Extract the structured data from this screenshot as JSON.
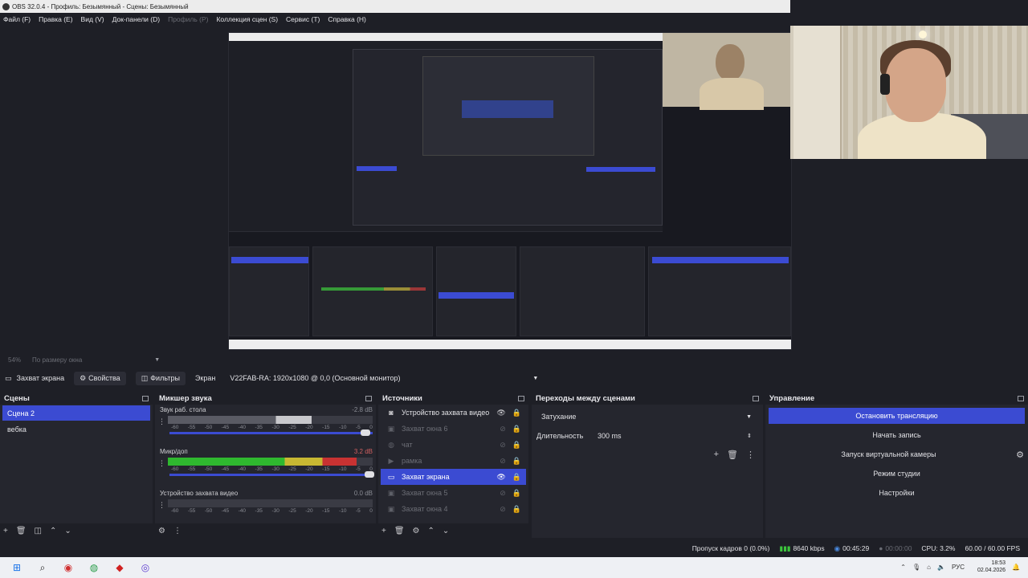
{
  "window": {
    "title": "OBS 32.0.4 - Профиль: Безымянный - Сцены: Безымянный"
  },
  "menu": [
    {
      "label": "Файл (F)",
      "enabled": true
    },
    {
      "label": "Правка (E)",
      "enabled": true
    },
    {
      "label": "Вид (V)",
      "enabled": true
    },
    {
      "label": "Док-панели (D)",
      "enabled": true
    },
    {
      "label": "Профиль (P)",
      "enabled": false
    },
    {
      "label": "Коллекция сцен (S)",
      "enabled": true
    },
    {
      "label": "Сервис (T)",
      "enabled": true
    },
    {
      "label": "Справка (H)",
      "enabled": true
    }
  ],
  "preview": {
    "zoom": "54%",
    "scale_mode": "По размеру окна"
  },
  "source_toolbar": {
    "source_name": "Захват экрана",
    "properties_label": "Свойства",
    "filters_label": "Фильтры",
    "screen_label": "Экран",
    "screen_value": "V22FAB-RA: 1920x1080 @ 0,0 (Основной монитор)"
  },
  "scenes": {
    "title": "Сцены",
    "items": [
      {
        "label": "Сцена 2",
        "active": true
      },
      {
        "label": "вебка",
        "active": false
      }
    ]
  },
  "mixer": {
    "title": "Микшер звука",
    "tracks": [
      {
        "name": "Звук раб. стола",
        "db": "-2.8 dB",
        "level": 0.7,
        "fader": 0.95,
        "muted": false
      },
      {
        "name": "Микр/доп",
        "db": "3.2 dB",
        "level": 0.92,
        "fader": 1.0,
        "muted": false
      },
      {
        "name": "Устройство захвата видео",
        "db": "0.0 dB",
        "level": 0.0,
        "fader": 1.0,
        "muted": false
      }
    ],
    "scale": [
      "-60",
      "-55",
      "-50",
      "-45",
      "-40",
      "-35",
      "-30",
      "-25",
      "-20",
      "-15",
      "-10",
      "-5",
      "0"
    ]
  },
  "sources": {
    "title": "Источники",
    "items": [
      {
        "label": "Устройство захвата видео",
        "icon": "video-camera-icon",
        "visible": true,
        "state": "normal"
      },
      {
        "label": "Захват окна 6",
        "icon": "window-icon",
        "visible": false,
        "state": "dim"
      },
      {
        "label": "чат",
        "icon": "browser-icon",
        "visible": false,
        "state": "dim"
      },
      {
        "label": "рамка",
        "icon": "media-icon",
        "visible": false,
        "state": "dim"
      },
      {
        "label": "Захват экрана",
        "icon": "monitor-icon",
        "visible": true,
        "state": "active"
      },
      {
        "label": "Захват окна 5",
        "icon": "window-icon",
        "visible": false,
        "state": "dim"
      },
      {
        "label": "Захват окна 4",
        "icon": "window-icon",
        "visible": false,
        "state": "dim"
      }
    ]
  },
  "transitions": {
    "title": "Переходы между сценами",
    "selected": "Затухание",
    "duration_label": "Длительность",
    "duration_value": "300 ms"
  },
  "controls": {
    "title": "Управление",
    "stop_stream": "Остановить трансляцию",
    "start_record": "Начать запись",
    "virtual_cam": "Запуск виртуальной камеры",
    "studio_mode": "Режим студии",
    "settings": "Настройки"
  },
  "status": {
    "dropped": "Пропуск кадров 0 (0.0%)",
    "bitrate": "8640 kbps",
    "stream_time": "00:45:29",
    "record_time": "00:00:00",
    "cpu": "CPU: 3.2%",
    "fps": "60.00 / 60.00 FPS"
  },
  "taskbar": {
    "lang": "РУС",
    "time": "18:53",
    "date": "02.04.2026"
  },
  "colors": {
    "accent": "#3b4bd2",
    "bg": "#1e1f26",
    "dock": "#25262e"
  }
}
